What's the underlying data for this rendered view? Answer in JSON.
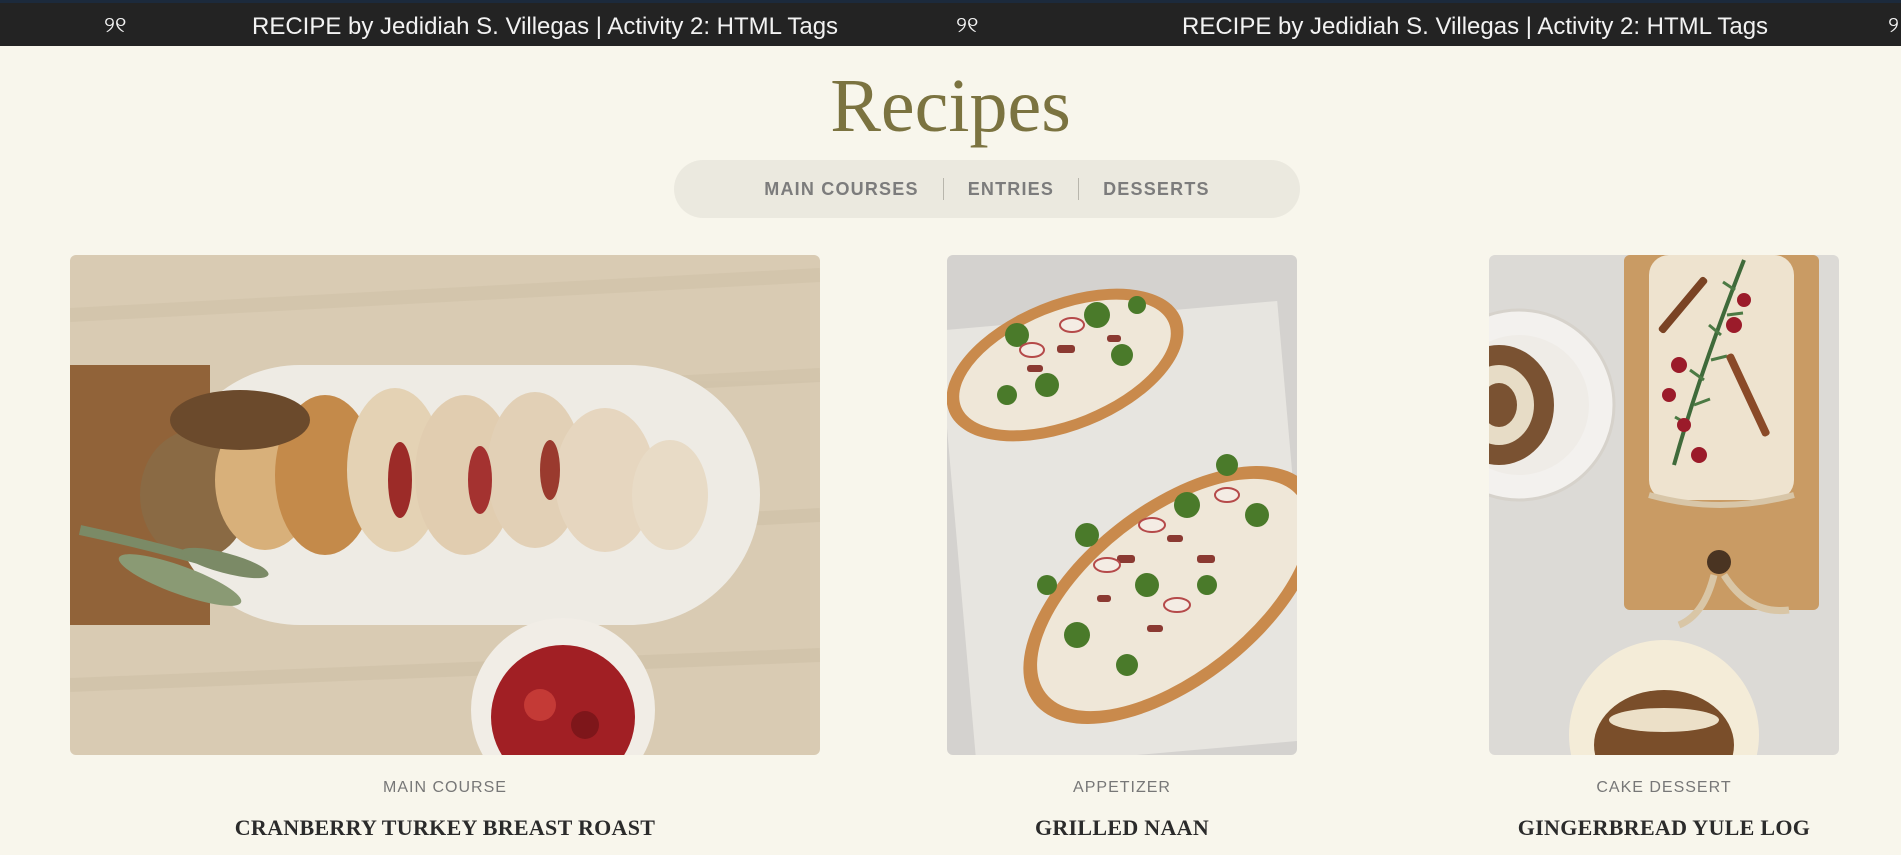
{
  "banner": {
    "logo_glyph": "୨୧",
    "text": "RECIPE by Jedidiah S. Villegas | Activity 2: HTML Tags",
    "text_repeat": "RECIPE by Jedidiah S. Villegas | Activity 2: HTML Tags",
    "logo_glyph_2": "୨୧",
    "logo_glyph_3": "୨"
  },
  "page": {
    "title": "Recipes"
  },
  "nav": {
    "items": [
      {
        "label": "MAIN COURSES"
      },
      {
        "label": "ENTRIES"
      },
      {
        "label": "DESSERTS"
      }
    ]
  },
  "recipes": [
    {
      "category": "MAIN COURSE",
      "name": "CRANBERRY TURKEY BREAST ROAST",
      "image": "turkey-roast-photo"
    },
    {
      "category": "APPETIZER",
      "name": "GRILLED NAAN",
      "image": "grilled-naan-photo"
    },
    {
      "category": "CAKE DESSERT",
      "name": "GINGERBREAD YULE LOG",
      "image": "yule-log-photo"
    }
  ],
  "colors": {
    "background": "#f8f6ec",
    "banner": "#232323",
    "title": "#7b7340",
    "nav_bg": "#ebe9df"
  }
}
